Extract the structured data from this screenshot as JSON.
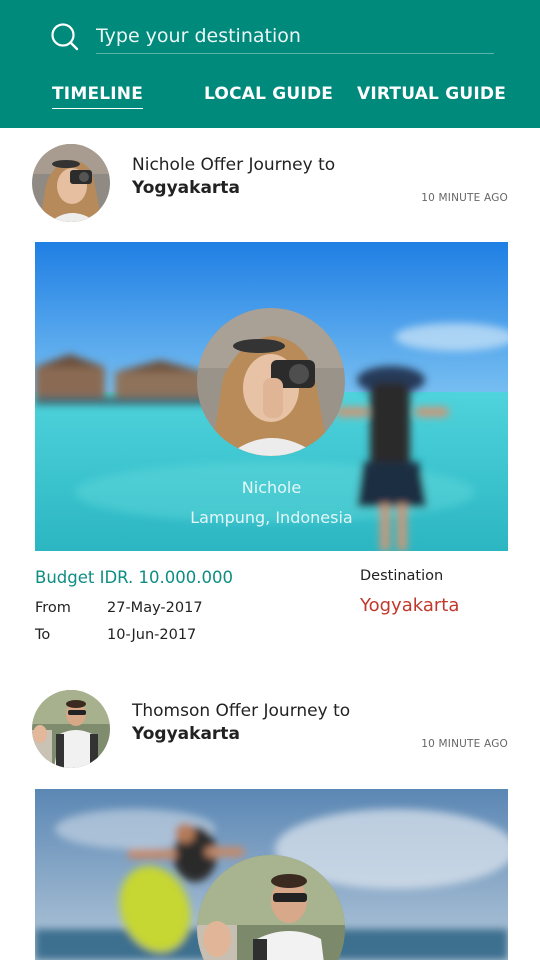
{
  "search": {
    "placeholder": "Type your destination"
  },
  "tabs": [
    {
      "label": "TIMELINE",
      "active": true
    },
    {
      "label": "LOCAL GUIDE",
      "active": false
    },
    {
      "label": "VIRTUAL GUIDE",
      "active": false
    }
  ],
  "colors": {
    "header": "#008a7c",
    "budget": "#0e8e82",
    "destination": "#c0392b"
  },
  "posts": [
    {
      "title": "Nichole Offer Journey to",
      "destination": "Yogyakarta",
      "time": "10 MINUTE AGO",
      "guide_name": "Nichole",
      "guide_location": "Lampung, Indonesia",
      "budget": "Budget IDR. 10.000.000",
      "destination_label": "Destination",
      "destination_value": "Yogyakarta",
      "from_label": "From",
      "from_date": "27-May-2017",
      "to_label": "To",
      "to_date": "10-Jun-2017"
    },
    {
      "title": "Thomson Offer Journey to",
      "destination": "Yogyakarta",
      "time": "10 MINUTE AGO"
    }
  ]
}
